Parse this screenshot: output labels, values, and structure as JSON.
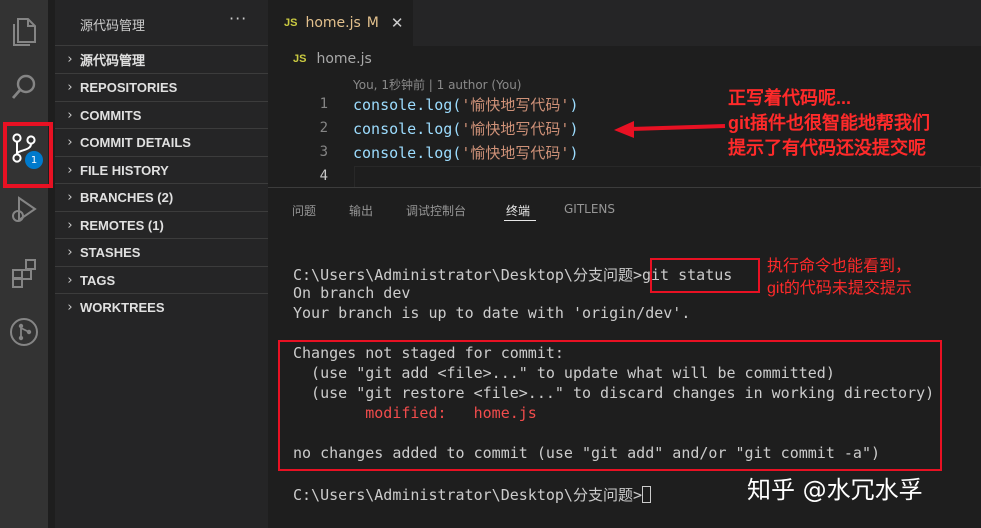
{
  "colors": {
    "accent": "#007acc",
    "annotation": "#ff2a2a",
    "string": "#ce9178",
    "identifier": "#9cdcfe",
    "modified": "#e2c08d"
  },
  "activity_bar": {
    "icons": [
      "files-icon",
      "search-icon",
      "source-control-icon",
      "run-debug-icon",
      "extensions-icon",
      "gitlens-icon"
    ],
    "scm_badge": "1"
  },
  "sidebar": {
    "title": "源代码管理",
    "more": "···",
    "sections": [
      {
        "label": "源代码管理"
      },
      {
        "label": "REPOSITORIES"
      },
      {
        "label": "COMMITS"
      },
      {
        "label": "COMMIT DETAILS"
      },
      {
        "label": "FILE HISTORY"
      },
      {
        "label": "BRANCHES (2)"
      },
      {
        "label": "REMOTES (1)"
      },
      {
        "label": "STASHES"
      },
      {
        "label": "TAGS"
      },
      {
        "label": "WORKTREES"
      }
    ]
  },
  "editor": {
    "tab": {
      "icon": "JS",
      "name": "home.js",
      "modified": "M",
      "close": "✕"
    },
    "breadcrumb": {
      "icon": "JS",
      "name": "home.js"
    },
    "codelens": "You, 1秒钟前 | 1 author (You)",
    "lines": [
      {
        "num": "1",
        "fn": "console.log(",
        "str": "'愉快地写代码'",
        "end": ")"
      },
      {
        "num": "2",
        "fn": "console.log(",
        "str": "'愉快地写代码'",
        "end": ")"
      },
      {
        "num": "3",
        "fn": "console.log(",
        "str": "'愉快地写代码'",
        "end": ")"
      },
      {
        "num": "4",
        "fn": "",
        "str": "",
        "end": ""
      }
    ]
  },
  "annotations": {
    "editor_note": [
      "正写着代码呢...",
      "git插件也很智能地帮我们",
      "提示了有代码还没提交呢"
    ],
    "terminal_note": [
      "执行命令也能看到，",
      "git的代码未提交提示"
    ]
  },
  "panel": {
    "tabs": [
      "问题",
      "输出",
      "调试控制台",
      "终端",
      "GITLENS"
    ],
    "active_tab": "终端"
  },
  "terminal": {
    "prompt_cmd": "C:\\Users\\Administrator\\Desktop\\分支问题>git status",
    "line1": "On branch dev",
    "line2": "Your branch is up to date with 'origin/dev'.",
    "line3": "Changes not staged for commit:",
    "line4": "  (use \"git add <file>...\" to update what will be committed)",
    "line5": "  (use \"git restore <file>...\" to discard changes in working directory)",
    "line6": "        modified:   home.js",
    "line7": "no changes added to commit (use \"git add\" and/or \"git commit -a\")",
    "prompt_end": "C:\\Users\\Administrator\\Desktop\\分支问题>"
  },
  "watermark": "知乎 @水冗水孚"
}
